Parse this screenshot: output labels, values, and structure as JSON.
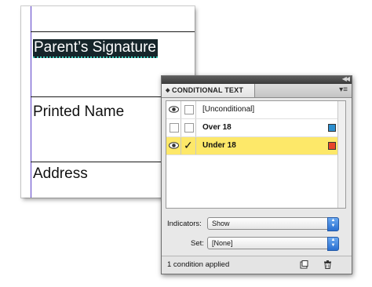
{
  "document": {
    "lines": [
      {
        "text": "Parent’s Signature",
        "selected": true
      },
      {
        "text": "Printed Name",
        "selected": false
      },
      {
        "text": "Address",
        "selected": false
      }
    ]
  },
  "panel": {
    "title": "CONDITIONAL TEXT",
    "collapse_icon": "double-chevron-right-icon",
    "menu_icon": "panel-menu-icon",
    "conditions": [
      {
        "label": "[Unconditional]",
        "visible": true,
        "applied": false,
        "swatch": null,
        "selected": false,
        "bold": false
      },
      {
        "label": "Over 18",
        "visible": false,
        "applied": false,
        "swatch": "#2c8fd0",
        "selected": false,
        "bold": true
      },
      {
        "label": "Under 18",
        "visible": true,
        "applied": true,
        "swatch": "#e8452a",
        "selected": true,
        "bold": true
      }
    ],
    "indicators": {
      "label": "Indicators:",
      "value": "Show"
    },
    "set": {
      "label": "Set:",
      "value": "[None]"
    },
    "status": "1 condition applied",
    "footer_icons": [
      "new-condition-icon",
      "trash-icon"
    ]
  },
  "colors": {
    "selected_row": "#fde869",
    "selection_highlight": "#16252a",
    "guide": "#5a3fc8"
  }
}
